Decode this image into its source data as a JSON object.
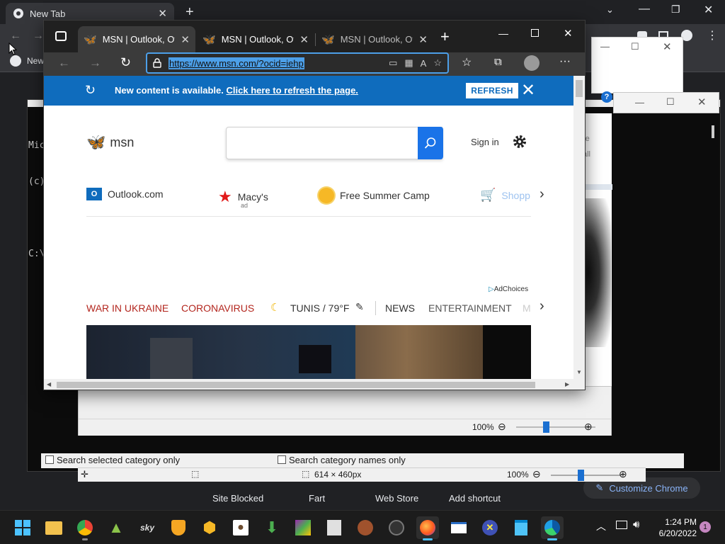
{
  "chrome": {
    "tab_title": "New Tab",
    "bookmark_new": "New",
    "shortcuts": [
      "Site Blocked",
      "Fart",
      "Web Store",
      "Add shortcut"
    ],
    "customize_label": "Customize Chrome"
  },
  "cmd": {
    "lines": [
      "Mic",
      "(c)",
      "",
      "C:\\"
    ]
  },
  "image_viewer": {
    "zoom": "100%",
    "dimensions": "614 × 460px",
    "zoom2": "100%",
    "filter_selected": "Search selected category only",
    "filter_names": "Search category names only",
    "side_texts": [
      "re",
      "all"
    ]
  },
  "edge": {
    "tabs": [
      {
        "label": "MSN | Outlook, Off"
      },
      {
        "label": "MSN | Outlook, Off"
      },
      {
        "label": "MSN | Outlook, Off"
      }
    ],
    "url": "https://www.msn.com/?ocid=iehp",
    "notification": {
      "text": "New content is available.",
      "link": "Click here to refresh the page.",
      "button": "REFRESH"
    },
    "page": {
      "logo": "msn",
      "search_placeholder": "",
      "signin": "Sign in",
      "quicklinks": [
        "Outlook.com",
        "Macy's",
        "Free Summer Camp",
        "Shopp"
      ],
      "macys_ad": "ad",
      "adchoices": "AdChoices",
      "categories": {
        "war": "WAR IN UKRAINE",
        "corona": "CORONAVIRUS",
        "weather": "TUNIS / 79°F",
        "news": "NEWS",
        "entertainment": "ENTERTAINMENT",
        "more": "M"
      }
    }
  },
  "taskbar": {
    "time": "1:24 PM",
    "date": "6/20/2022",
    "notifications": "1"
  },
  "colors": {
    "edge_blue": "#0f6cbd",
    "accent": "#4c9fe8",
    "category_red": "#b3261e"
  }
}
